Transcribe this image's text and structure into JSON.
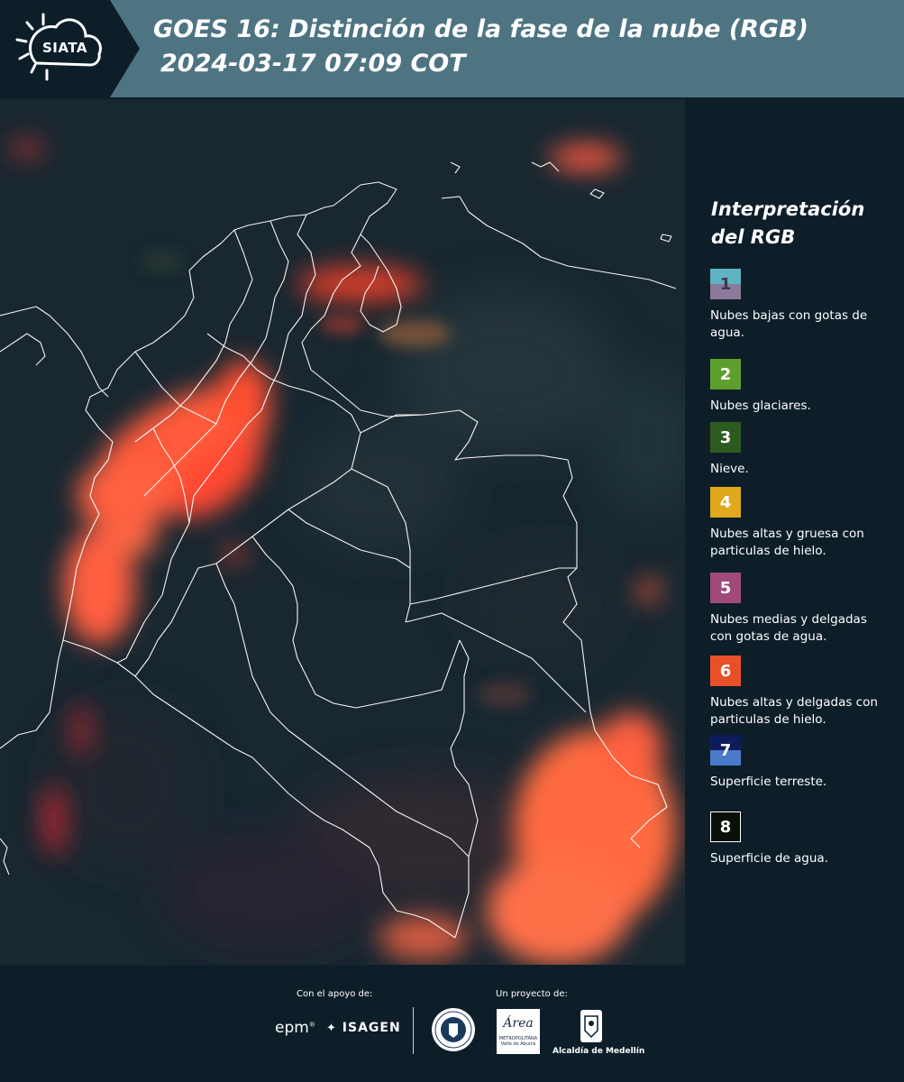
{
  "header": {
    "logo_text": "SIATA",
    "title": "GOES 16: Distinción de la fase de la nube (RGB)",
    "timestamp": "2024-03-17 07:09 COT"
  },
  "legend": {
    "title_line1": "Interpretación",
    "title_line2": "del RGB",
    "items": [
      {
        "number": "1",
        "label": "Nubes bajas con gotas de agua.",
        "color_top": "#5fb3c2",
        "color_bottom": "#8b7a9a"
      },
      {
        "number": "2",
        "label": "Nubes glaciares.",
        "color_top": "#5e9e2f",
        "color_bottom": "#5e9e2f"
      },
      {
        "number": "3",
        "label": "Nieve.",
        "color_top": "#2d5a1e",
        "color_bottom": "#2d5a1e"
      },
      {
        "number": "4",
        "label": "Nubes altas y gruesa con particulas de hielo.",
        "color_top": "#e0a81c",
        "color_bottom": "#e0a81c"
      },
      {
        "number": "5",
        "label": "Nubes medias y delgadas con gotas de agua.",
        "color_top": "#a04a7c",
        "color_bottom": "#a04a7c"
      },
      {
        "number": "6",
        "label": "Nubes altas y delgadas con particulas de hielo.",
        "color_top": "#e8502a",
        "color_bottom": "#e8502a"
      },
      {
        "number": "7",
        "label": "Superficie terreste.",
        "color_top": "#0e1c5c",
        "color_bottom": "#4a7ac8"
      },
      {
        "number": "8",
        "label": "Superficie de agua.",
        "color_top": "#0a0f0a",
        "color_bottom": "#0a0f0a"
      }
    ]
  },
  "footer": {
    "support_label": "Con el apoyo de:",
    "project_label": "Un proyecto de:",
    "epm": "epm",
    "isagen": "ISAGEN",
    "area_name": "Área",
    "area_sub": "METROPOLITANA",
    "area_sub2": "Valle de Aburrá",
    "alcaldia": "Alcaldía de Medellín"
  }
}
